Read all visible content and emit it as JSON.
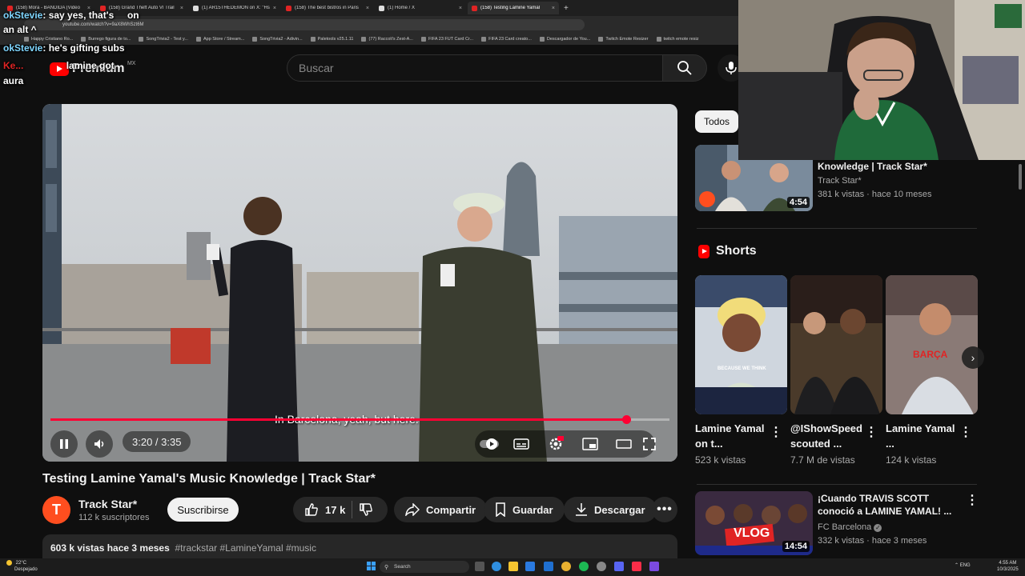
{
  "browser": {
    "tabs": [
      {
        "label": "(158) Mora - BANDIDA (Video",
        "active": false,
        "icon": "youtube-icon"
      },
      {
        "label": "(158) Grand Theft Auto VI Trail",
        "active": false,
        "icon": "youtube-icon"
      },
      {
        "label": "(1) AR15THEDEMON on X: \"Hs",
        "active": false,
        "icon": "x-icon"
      },
      {
        "label": "(158) The best bistros in Paris",
        "active": false,
        "icon": "youtube-icon"
      },
      {
        "label": "(1) Home / X",
        "active": false,
        "icon": "x-icon"
      },
      {
        "label": "(158) Testing Lamine Yamal",
        "active": true,
        "icon": "youtube-icon"
      }
    ],
    "new_tab": "+",
    "url": "youtube.com/watch?v=9aX8WhSzt6M",
    "bookmarks": [
      "Happy Cristiano Ro...",
      "Burrego figura de to...",
      "SongTrivia2 - Test y...",
      "App Store / Stream...",
      "SongTrivia2 - Adivin...",
      "Paletools v25.1.11",
      "(77) Raccoli's Zest-A...",
      "FIFA 23 FUT Card Cr...",
      "FIFA 23 Card creato...",
      "Descargador de You...",
      "Twitch Emote Resizer",
      "twitch emote resiz"
    ]
  },
  "chat": [
    {
      "user": "okStevie",
      "message": ": say yes, that's",
      "extra": "on"
    },
    {
      "user": "",
      "message": "an alt ^",
      "extra": ""
    },
    {
      "user": "okStevie",
      "message": ": he's gifting subs",
      "extra": ""
    },
    {
      "user": "Ke...",
      "message": "lamine got",
      "extra": ""
    },
    {
      "user": "",
      "message": "aura",
      "extra": ""
    }
  ],
  "youtube": {
    "logo_text": "Premium",
    "logo_country": "MX",
    "search_placeholder": "Buscar"
  },
  "video": {
    "subtitle": "In Barcelona, yeah, but here.",
    "time": "3:20 / 3:35",
    "progress": 0.93,
    "title": "Testing Lamine Yamal's Music Knowledge | Track Star*",
    "channel": "Track Star*",
    "subscribers": "112 k suscriptores",
    "subscribe_label": "Suscribirse",
    "likes": "17 k",
    "share_label": "Compartir",
    "save_label": "Guardar",
    "download_label": "Descargar",
    "views_date": "603 k vistas  hace 3 meses",
    "hashtags": "#trackstar #LamineYamal #music",
    "colors": {
      "accent": "#ff0033",
      "channel": "#ff4e1f"
    }
  },
  "sidebar": {
    "chip": "Todos",
    "reco1": {
      "title": "Knowledge | Track Star*",
      "channel": "Track Star*",
      "meta": "381 k vistas · hace 10 meses",
      "duration": "4:54"
    },
    "shorts_label": "Shorts",
    "shorts": [
      {
        "title": "Lamine Yamal on t...",
        "views": "523 k vistas",
        "caption": "BECAUSE WE THINK"
      },
      {
        "title": "@IShowSpeed scouted ...",
        "views": "7.7 M de vistas",
        "caption": ""
      },
      {
        "title": "Lamine Yamal ...",
        "views": "124 k vistas",
        "caption": "BARÇA"
      }
    ],
    "reco2": {
      "title": "¡Cuando TRAVIS SCOTT conoció a LAMINE YAMAL! ...",
      "channel": "FC Barcelona",
      "meta": "332 k vistas · hace 3 meses",
      "duration": "14:54",
      "thumb_text": "VLOG"
    }
  },
  "taskbar": {
    "weather_temp": "22°C",
    "weather_desc": "Despejado",
    "search": "Search",
    "lang": "ENG",
    "time": "4:55 AM",
    "date": "10/3/2025"
  }
}
